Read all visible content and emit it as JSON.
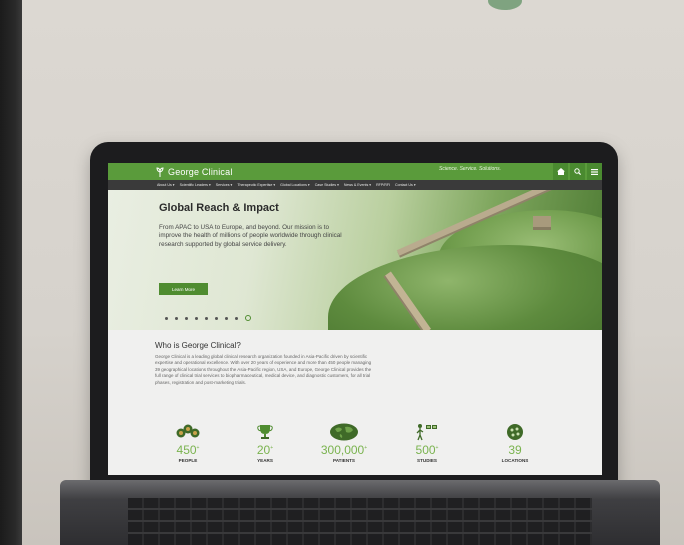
{
  "site": {
    "brand": "George Clinical",
    "tagline": "Science. Service. Solutions."
  },
  "nav": {
    "items": [
      "About Us ▾",
      "Scientific Leaders ▾",
      "Services ▾",
      "Therapeutic Expertise ▾",
      "Global Locations ▾",
      "Case Studies ▾",
      "News & Events ▾",
      "RFP/RFI",
      "Contact Us ▾"
    ]
  },
  "hero": {
    "title": "Global Reach & Impact",
    "text": "From APAC to USA to Europe, and beyond. Our mission is to improve the health of millions of people worldwide through clinical research supported by global service delivery.",
    "button": "Learn More"
  },
  "who": {
    "title": "Who is George Clinical?",
    "text": "George Clinical is a leading global clinical research organization founded in Asia-Pacific driven by scientific expertise and operational excellence. With over 20 years of experience and more than 450 people managing 39 geographical locations throughout the Asia-Pacific region, USA, and Europe, George Clinical provides the full range of clinical trial services to biopharmaceutical, medical device, and diagnostic customers, for all trial phases, registration and post-marketing trials."
  },
  "stats": [
    {
      "value": "450",
      "suffix": "+",
      "label": "PEOPLE",
      "icon": "people-icon"
    },
    {
      "value": "20",
      "suffix": "+",
      "label": "YEARS",
      "icon": "trophy-icon"
    },
    {
      "value": "300,000",
      "suffix": "+",
      "label": "PATIENTS",
      "icon": "globe-icon"
    },
    {
      "value": "500",
      "suffix": "+",
      "label": "STUDIES",
      "icon": "studies-icon"
    },
    {
      "value": "39",
      "suffix": "",
      "label": "LOCATIONS",
      "icon": "locations-icon"
    }
  ],
  "colors": {
    "brand_green": "#5a9b3b",
    "nav_dark": "#3a3a3a",
    "stat_green": "#7ab34f"
  }
}
